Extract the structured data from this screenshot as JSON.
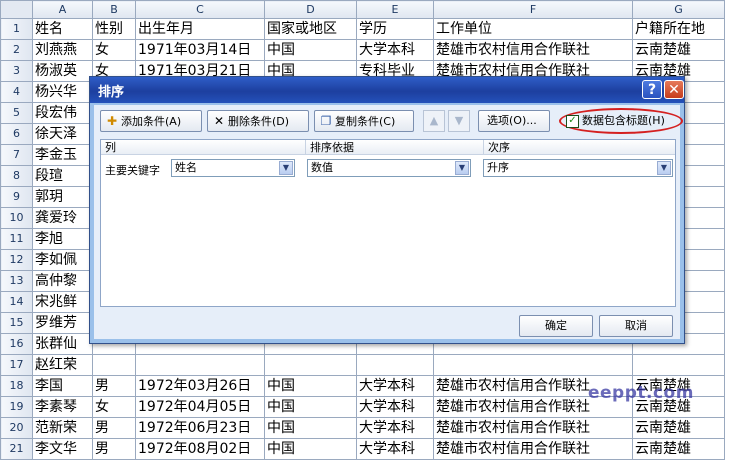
{
  "sheet": {
    "columns": [
      "A",
      "B",
      "C",
      "D",
      "E",
      "F",
      "G"
    ],
    "rows": [
      {
        "n": "1",
        "name": "姓名",
        "gender": "性别",
        "birth": "出生年月",
        "country": "国家或地区",
        "edu": "学历",
        "work": "工作单位",
        "home": "户籍所在地"
      },
      {
        "n": "2",
        "name": "刘燕燕",
        "gender": "女",
        "birth": "1971年03月14日",
        "country": "中国",
        "edu": "大学本科",
        "work": "楚雄市农村信用合作联社",
        "home": "云南楚雄"
      },
      {
        "n": "3",
        "name": "杨淑英",
        "gender": "女",
        "birth": "1971年03月21日",
        "country": "中国",
        "edu": "专科毕业",
        "work": "楚雄市农村信用合作联社",
        "home": "云南楚雄"
      },
      {
        "n": "4",
        "name": "杨兴华",
        "gender": "",
        "birth": "",
        "country": "",
        "edu": "",
        "work": "",
        "home": ""
      },
      {
        "n": "5",
        "name": "段宏伟",
        "gender": "",
        "birth": "",
        "country": "",
        "edu": "",
        "work": "",
        "home": ""
      },
      {
        "n": "6",
        "name": "徐天泽",
        "gender": "",
        "birth": "",
        "country": "",
        "edu": "",
        "work": "",
        "home": ""
      },
      {
        "n": "7",
        "name": "李金玉",
        "gender": "",
        "birth": "",
        "country": "",
        "edu": "",
        "work": "",
        "home": ""
      },
      {
        "n": "8",
        "name": "段瑄",
        "gender": "",
        "birth": "",
        "country": "",
        "edu": "",
        "work": "",
        "home": ""
      },
      {
        "n": "9",
        "name": "郭玥",
        "gender": "",
        "birth": "",
        "country": "",
        "edu": "",
        "work": "",
        "home": ""
      },
      {
        "n": "10",
        "name": "龚爱玲",
        "gender": "",
        "birth": "",
        "country": "",
        "edu": "",
        "work": "",
        "home": ""
      },
      {
        "n": "11",
        "name": "李旭",
        "gender": "",
        "birth": "",
        "country": "",
        "edu": "",
        "work": "",
        "home": ""
      },
      {
        "n": "12",
        "name": "李如佩",
        "gender": "",
        "birth": "",
        "country": "",
        "edu": "",
        "work": "",
        "home": ""
      },
      {
        "n": "13",
        "name": "高仲黎",
        "gender": "",
        "birth": "",
        "country": "",
        "edu": "",
        "work": "",
        "home": ""
      },
      {
        "n": "14",
        "name": "宋兆鲜",
        "gender": "",
        "birth": "",
        "country": "",
        "edu": "",
        "work": "",
        "home": ""
      },
      {
        "n": "15",
        "name": "罗维芳",
        "gender": "",
        "birth": "",
        "country": "",
        "edu": "",
        "work": "",
        "home": ""
      },
      {
        "n": "16",
        "name": "张群仙",
        "gender": "",
        "birth": "",
        "country": "",
        "edu": "",
        "work": "",
        "home": ""
      },
      {
        "n": "17",
        "name": "赵红荣",
        "gender": "",
        "birth": "",
        "country": "",
        "edu": "",
        "work": "",
        "home": ""
      },
      {
        "n": "18",
        "name": "李国",
        "gender": "男",
        "birth": "1972年03月26日",
        "country": "中国",
        "edu": "大学本科",
        "work": "楚雄市农村信用合作联社",
        "home": "云南楚雄"
      },
      {
        "n": "19",
        "name": "李素琴",
        "gender": "女",
        "birth": "1972年04月05日",
        "country": "中国",
        "edu": "大学本科",
        "work": "楚雄市农村信用合作联社",
        "home": "云南楚雄"
      },
      {
        "n": "20",
        "name": "范新荣",
        "gender": "男",
        "birth": "1972年06月23日",
        "country": "中国",
        "edu": "大学本科",
        "work": "楚雄市农村信用合作联社",
        "home": "云南楚雄"
      },
      {
        "n": "21",
        "name": "李文华",
        "gender": "男",
        "birth": "1972年08月02日",
        "country": "中国",
        "edu": "大学本科",
        "work": "楚雄市农村信用合作联社",
        "home": "云南楚雄"
      }
    ]
  },
  "dialog": {
    "title": "排序",
    "help": "?",
    "close": "✕",
    "toolbar": {
      "add": "添加条件(A)",
      "delete": "删除条件(D)",
      "copy": "复制条件(C)",
      "up": "▲",
      "down": "▼",
      "options": "选项(O)...",
      "has_header": "数据包含标题(H)",
      "has_header_checked": "✓"
    },
    "list": {
      "col_header_1": "列",
      "col_header_2": "排序依据",
      "col_header_3": "次序",
      "row_label": "主要关键字",
      "key": "姓名",
      "basis": "数值",
      "order": "升序"
    },
    "ok": "确定",
    "cancel": "取消"
  },
  "watermark": "eeppt.com",
  "colors": {
    "title_bar": "#2451ba",
    "dialog_frame": "#9ac0ea",
    "highlight_ellipse": "#d42020"
  }
}
